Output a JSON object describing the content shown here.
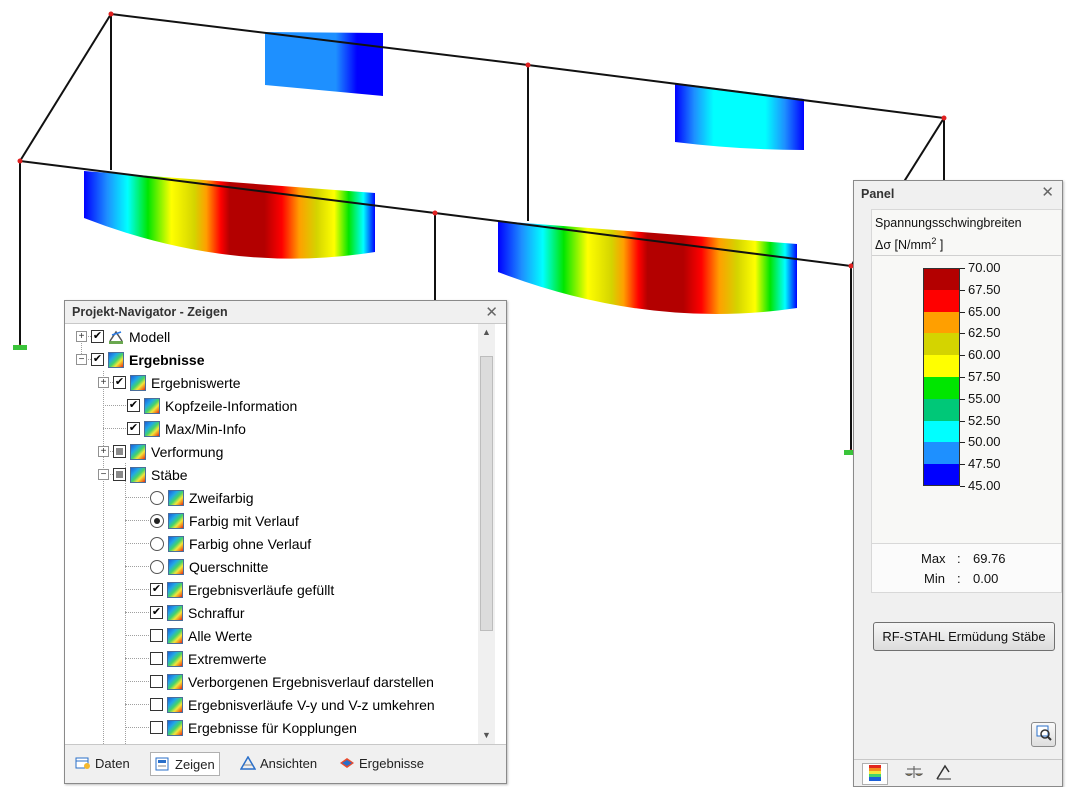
{
  "navigator": {
    "title": "Projekt-Navigator - Zeigen",
    "items": [
      {
        "label": "Modell",
        "bold": false
      },
      {
        "label": "Ergebnisse",
        "bold": true
      },
      {
        "label": "Ergebniswerte"
      },
      {
        "label": "Kopfzeile-Information"
      },
      {
        "label": "Max/Min-Info"
      },
      {
        "label": "Verformung"
      },
      {
        "label": "Stäbe"
      },
      {
        "label": "Zweifarbig"
      },
      {
        "label": "Farbig mit Verlauf"
      },
      {
        "label": "Farbig ohne Verlauf"
      },
      {
        "label": "Querschnitte"
      },
      {
        "label": "Ergebnisverläufe gefüllt"
      },
      {
        "label": "Schraffur"
      },
      {
        "label": "Alle Werte"
      },
      {
        "label": "Extremwerte"
      },
      {
        "label": "Verborgenen Ergebnisverlauf darstellen"
      },
      {
        "label": "Ergebnisverläufe V-y und V-z umkehren"
      },
      {
        "label": "Ergebnisse für Kopplungen"
      }
    ],
    "tabs": [
      {
        "label": "Daten"
      },
      {
        "label": "Zeigen"
      },
      {
        "label": "Ansichten"
      },
      {
        "label": "Ergebnisse"
      }
    ]
  },
  "panel": {
    "title": "Panel",
    "description": "Spannungsschwingbreiten",
    "unit_prefix": "Δσ [N/mm",
    "unit_exp": "2",
    "unit_suffix": " ]",
    "legend": {
      "labels": [
        "70.00",
        "67.50",
        "65.00",
        "62.50",
        "60.00",
        "57.50",
        "55.00",
        "52.50",
        "50.00",
        "47.50",
        "45.00"
      ],
      "colors": [
        "#b30000",
        "#ff0000",
        "#ff9f00",
        "#d4d400",
        "#ffff00",
        "#00e600",
        "#00c878",
        "#00ffff",
        "#1e90ff",
        "#0000ff"
      ]
    },
    "max_label": "Max",
    "max_value": "69.76",
    "min_label": "Min",
    "min_value": "0.00",
    "sep": ":",
    "module_button": "RF-STAHL Ermüdung Stäbe"
  },
  "colors": {
    "accent": "#1e90ff"
  }
}
